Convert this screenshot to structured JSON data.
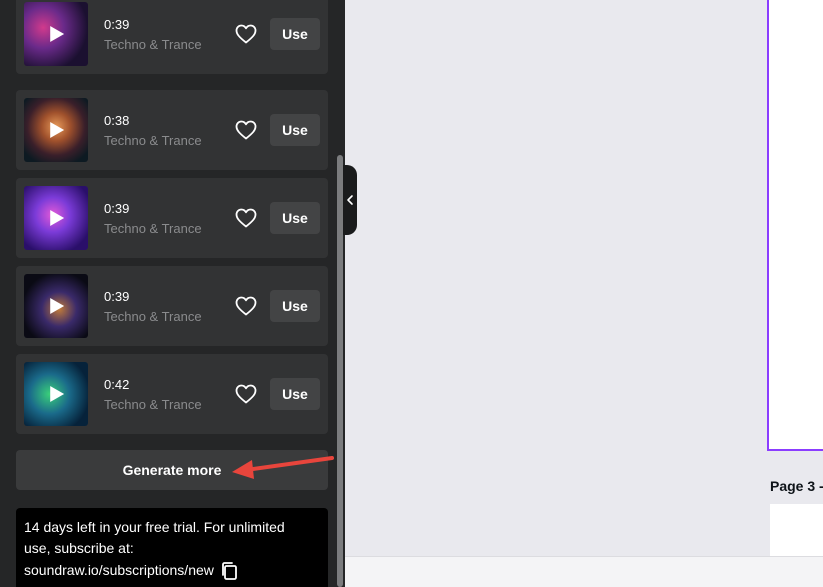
{
  "tracks": [
    {
      "duration": "0:39",
      "genre": "Techno & Trance",
      "use_label": "Use",
      "thumb_colors": [
        "#1b1030",
        "#6a2a8a",
        "#d13a8c"
      ]
    },
    {
      "duration": "0:38",
      "genre": "Techno & Trance",
      "use_label": "Use",
      "thumb_colors": [
        "#0d1a22",
        "#a0512c",
        "#e79a5a"
      ]
    },
    {
      "duration": "0:39",
      "genre": "Techno & Trance",
      "use_label": "Use",
      "thumb_colors": [
        "#2a0f6a",
        "#7b3bd8",
        "#e35ad8"
      ]
    },
    {
      "duration": "0:39",
      "genre": "Techno & Trance",
      "use_label": "Use",
      "thumb_colors": [
        "#0a0a14",
        "#3a2a6a",
        "#c07a3a"
      ]
    },
    {
      "duration": "0:42",
      "genre": "Techno & Trance",
      "use_label": "Use",
      "thumb_colors": [
        "#06223a",
        "#1a6a8a",
        "#3ad07a"
      ]
    }
  ],
  "generate_button": {
    "label": "Generate more"
  },
  "trial_notice": {
    "line1": "14 days left in your free trial. For unlimited",
    "line2": "use, subscribe at:",
    "link": "soundraw.io/subscriptions/new"
  },
  "canvas": {
    "page_label": "Page 3 -"
  },
  "icons": {
    "play": "play-icon",
    "heart": "heart-icon",
    "copy": "copy-icon",
    "collapse": "chevron-left-icon",
    "arrow": "red-arrow-annotation"
  },
  "colors": {
    "panel_bg": "#252627",
    "card_bg": "#323334",
    "accent_purple": "#8b3dff",
    "annotation_red": "#e8453c"
  }
}
